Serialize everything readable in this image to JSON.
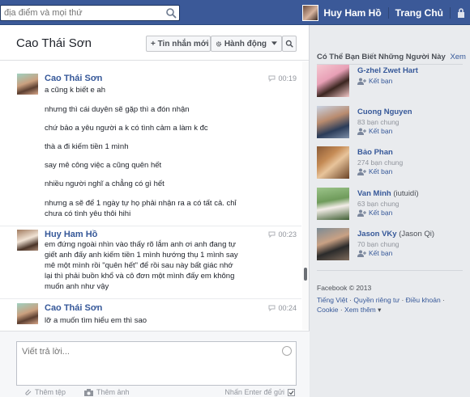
{
  "topbar": {
    "search_placeholder": "địa điểm và mọi thứ",
    "user_name": "Huy Ham Hồ",
    "home_label": "Trang Chủ"
  },
  "chat": {
    "title": "Cao Thái Sơn",
    "new_message_label": "+ Tin nhắn mới",
    "actions_label": "Hành động",
    "messages": [
      {
        "sender": "Cao Thái Sơn",
        "time": "00:19",
        "lines": [
          "a cũng k biết e ah",
          "nhưng thì cái duyên sẽ gặp thì a đón nhận",
          "chứ bảo a yêu người a k có tình cảm a làm k đc",
          "thà a đi kiếm tiền 1 mình",
          "say mê công việc a cũng quên hết",
          "nhiều người nghĩ a chẳng có gì hết",
          "nhưng a sẽ để 1 ngày tự họ phải nhận ra a có tất cả. chỉ",
          "chưa có tình yêu thôi hihi"
        ]
      },
      {
        "sender": "Huy Ham Hồ",
        "time": "00:23",
        "lines": [
          "em đứng ngoài nhìn vào thấy rõ lắm anh ơi anh đang tự",
          "giết anh đấy  anh kiếm tiền 1 mình hướng thụ 1 mình say",
          "mê một mình rồi \"quên hết\" để rồi sau này bất giác nhớ",
          "lại thì phải buồn khổ và cô đơn một mình đấy em không",
          "muốn anh như vậy"
        ]
      },
      {
        "sender": "Cao Thái Sơn",
        "time": "00:24",
        "lines": [
          "lỡ a muốn tìm hiểu em thì sao"
        ]
      }
    ],
    "reply_placeholder": "Viết trả lời...",
    "attach_file_label": "Thêm tệp",
    "attach_photo_label": "Thêm ảnh",
    "enter_to_send_label": "Nhấn Enter để gửi"
  },
  "sidebar": {
    "heading": "Có Thể Bạn Biết Những Người Này",
    "see_all_label": "Xem",
    "add_friend_label": "Kết bạn",
    "people": [
      {
        "name": "G-zhel Zwet Hart",
        "extra": "",
        "mutual": ""
      },
      {
        "name": "Cuong Nguyen",
        "extra": "",
        "mutual": "83 bạn chung"
      },
      {
        "name": "Bảo Phan",
        "extra": "",
        "mutual": "274 bạn chung"
      },
      {
        "name": "Van Minh",
        "extra": "(iutuidi)",
        "mutual": "63 bạn chung"
      },
      {
        "name": "Jason VKy",
        "extra": "(Jason Qi)",
        "mutual": "70 bạn chung"
      }
    ],
    "footer": {
      "copyright": "Facebook © 2013",
      "language": "Tiếng Việt",
      "privacy": "Quyền riêng tư",
      "terms": "Điều khoản",
      "cookie": "Cookie",
      "more": "Xem thêm"
    }
  },
  "colors": {
    "brand_blue": "#3b5998",
    "link_blue": "#365899",
    "background": "#e9ebee"
  }
}
